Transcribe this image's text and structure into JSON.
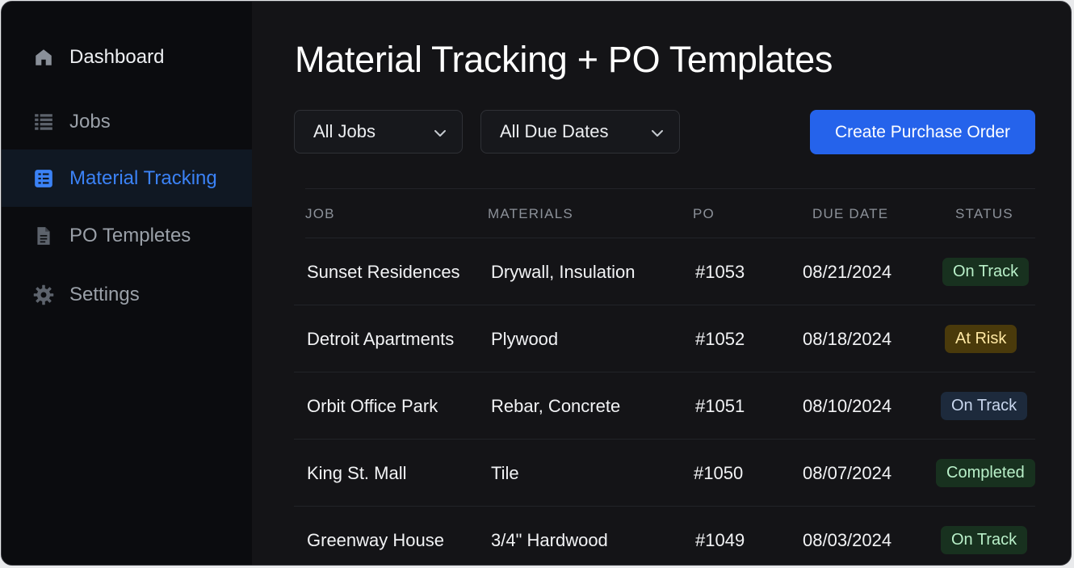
{
  "sidebar": {
    "items": [
      {
        "label": "Dashboard",
        "icon": "home-icon"
      },
      {
        "label": "Jobs",
        "icon": "list-icon"
      },
      {
        "label": "Material Tracking",
        "icon": "checklist-icon",
        "active": true
      },
      {
        "label": "PO Templetes",
        "icon": "document-icon"
      },
      {
        "label": "Settings",
        "icon": "gear-icon"
      }
    ]
  },
  "main": {
    "title": "Material Tracking + PO Templates",
    "filters": {
      "jobs": "All Jobs",
      "due_dates": "All Due Dates"
    },
    "create_button": "Create Purchase Order"
  },
  "table": {
    "headers": [
      "JOB",
      "MATERIALS",
      "PO",
      "DUE DATE",
      "STATUS"
    ],
    "rows": [
      {
        "job": "Sunset Residences",
        "materials": "Drywall, Insulation",
        "po": "#1053",
        "due": "08/21/2024",
        "status": "On Track"
      },
      {
        "job": "Detroit Apartments",
        "materials": "Plywood",
        "po": "#1052",
        "due": "08/18/2024",
        "status": "At Risk"
      },
      {
        "job": "Orbit Office Park",
        "materials": "Rebar, Concrete",
        "po": "#1051",
        "due": "08/10/2024",
        "status": "On Track"
      },
      {
        "job": "King St. Mall",
        "materials": "Tile",
        "po": "#1050",
        "due": "08/07/2024",
        "status": "Completed"
      },
      {
        "job": "Greenway House",
        "materials": "3/4\" Hardwood",
        "po": "#1049",
        "due": "08/03/2024",
        "status": "On Track"
      }
    ]
  },
  "colors": {
    "accent": "#2563eb",
    "active_nav": "#3b82f6",
    "on_track": "#18311f",
    "at_risk": "#4a3a0b",
    "on_track_alt": "#1d2a3c"
  }
}
